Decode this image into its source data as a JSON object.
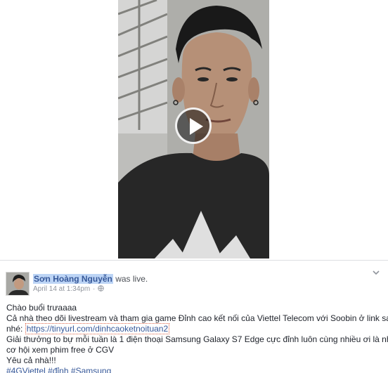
{
  "video": {
    "play_label": "Play"
  },
  "post": {
    "author": "Sơn Hoàng Nguyễn",
    "action_text": "was live.",
    "timestamp": "April 14 at 1:34pm",
    "separator": "·",
    "privacy_icon": "globe-icon",
    "menu_icon": "chevron-down-icon",
    "lines": {
      "line1": "Chào buổi trưaaaa",
      "line2": "Cả nhà theo dõi livestream và tham gia game Đỉnh cao kết nối của Viettel Telecom với Soobin ở link sau",
      "line3_prefix": "nhé:",
      "link": "https://tinyurl.com/dinhcaoketnoituan2",
      "line4": "Giải thưởng to bự mỗi tuần là 1 điện thoại Samsung Galaxy S7 Edge cực đỉnh luôn cùng nhiều cơ hội xem phim free ở CGV",
      "line4a": "Giải thưởng to bự mỗi tuần là 1 điện thoại Samsung Galaxy S7 Edge cực đỉnh luôn cùng nhiều ơi là nhiều",
      "line5": "cơ hội xem phim free ở CGV",
      "line6": "Yêu cả nhà!!!"
    },
    "hashtags": [
      "#4GViettel",
      "#đỉnh",
      "#Samsung"
    ]
  },
  "colors": {
    "link": "#365899",
    "author_highlight": "#bcd4f5",
    "meta": "#90949c"
  }
}
